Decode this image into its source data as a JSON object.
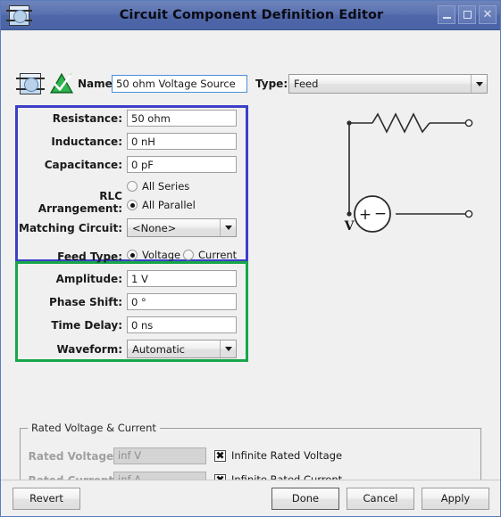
{
  "window": {
    "title": "Circuit Component Definition Editor",
    "icon": "component-icon",
    "minimize_label": "–",
    "maximize_label": "□",
    "close_label": "✕"
  },
  "header": {
    "component_icon": "component-icon",
    "validate_icon": "green-check-triangle-icon",
    "name_label": "Name:",
    "name_value": "50 ohm Voltage Source",
    "type_label": "Type:",
    "type_value": "Feed"
  },
  "rlc_section": {
    "highlight_color": "#3b3fc8",
    "resistance_label": "Resistance:",
    "resistance_value": "50 ohm",
    "inductance_label": "Inductance:",
    "inductance_value": "0 nH",
    "capacitance_label": "Capacitance:",
    "capacitance_value": "0 pF",
    "arrangement_label": "RLC Arrangement:",
    "arrangement_option_series": "All Series",
    "arrangement_option_parallel": "All Parallel",
    "arrangement_selected": "All Parallel",
    "matching_label": "Matching Circuit:",
    "matching_value": "<None>",
    "feed_type_label": "Feed Type:",
    "feed_type_option_voltage": "Voltage",
    "feed_type_option_current": "Current",
    "feed_type_selected": "Voltage"
  },
  "feed_section": {
    "highlight_color": "#17a74a",
    "amplitude_label": "Amplitude:",
    "amplitude_value": "1 V",
    "phase_label": "Phase Shift:",
    "phase_value": "0 °",
    "delay_label": "Time Delay:",
    "delay_value": "0 ns",
    "waveform_label": "Waveform:",
    "waveform_value": "Automatic"
  },
  "circuit_preview": {
    "source_label": "V",
    "source_plus": "+",
    "source_minus": "−",
    "elements": [
      "resistor",
      "voltage-source",
      "terminal-top",
      "terminal-bottom"
    ]
  },
  "rated_group": {
    "title": "Rated Voltage & Current",
    "voltage_label": "Rated Voltage:",
    "voltage_value": "inf V",
    "voltage_checkbox_label": "Infinite Rated Voltage",
    "voltage_checkbox_checked": true,
    "current_label": "Rated Current:",
    "current_value": "inf A",
    "current_checkbox_label": "Infinite Rated Current",
    "current_checkbox_checked": true,
    "check_glyph": "✖"
  },
  "buttons": {
    "revert": "Revert",
    "done": "Done",
    "cancel": "Cancel",
    "apply": "Apply"
  }
}
